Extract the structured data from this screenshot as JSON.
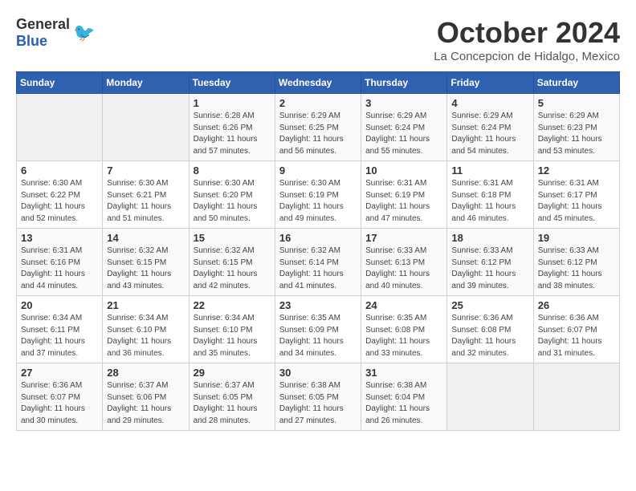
{
  "logo": {
    "general": "General",
    "blue": "Blue"
  },
  "title": "October 2024",
  "location": "La Concepcion de Hidalgo, Mexico",
  "headers": [
    "Sunday",
    "Monday",
    "Tuesday",
    "Wednesday",
    "Thursday",
    "Friday",
    "Saturday"
  ],
  "weeks": [
    [
      {
        "num": "",
        "sunrise": "",
        "sunset": "",
        "daylight": ""
      },
      {
        "num": "",
        "sunrise": "",
        "sunset": "",
        "daylight": ""
      },
      {
        "num": "1",
        "sunrise": "Sunrise: 6:28 AM",
        "sunset": "Sunset: 6:26 PM",
        "daylight": "Daylight: 11 hours and 57 minutes."
      },
      {
        "num": "2",
        "sunrise": "Sunrise: 6:29 AM",
        "sunset": "Sunset: 6:25 PM",
        "daylight": "Daylight: 11 hours and 56 minutes."
      },
      {
        "num": "3",
        "sunrise": "Sunrise: 6:29 AM",
        "sunset": "Sunset: 6:24 PM",
        "daylight": "Daylight: 11 hours and 55 minutes."
      },
      {
        "num": "4",
        "sunrise": "Sunrise: 6:29 AM",
        "sunset": "Sunset: 6:24 PM",
        "daylight": "Daylight: 11 hours and 54 minutes."
      },
      {
        "num": "5",
        "sunrise": "Sunrise: 6:29 AM",
        "sunset": "Sunset: 6:23 PM",
        "daylight": "Daylight: 11 hours and 53 minutes."
      }
    ],
    [
      {
        "num": "6",
        "sunrise": "Sunrise: 6:30 AM",
        "sunset": "Sunset: 6:22 PM",
        "daylight": "Daylight: 11 hours and 52 minutes."
      },
      {
        "num": "7",
        "sunrise": "Sunrise: 6:30 AM",
        "sunset": "Sunset: 6:21 PM",
        "daylight": "Daylight: 11 hours and 51 minutes."
      },
      {
        "num": "8",
        "sunrise": "Sunrise: 6:30 AM",
        "sunset": "Sunset: 6:20 PM",
        "daylight": "Daylight: 11 hours and 50 minutes."
      },
      {
        "num": "9",
        "sunrise": "Sunrise: 6:30 AM",
        "sunset": "Sunset: 6:19 PM",
        "daylight": "Daylight: 11 hours and 49 minutes."
      },
      {
        "num": "10",
        "sunrise": "Sunrise: 6:31 AM",
        "sunset": "Sunset: 6:19 PM",
        "daylight": "Daylight: 11 hours and 47 minutes."
      },
      {
        "num": "11",
        "sunrise": "Sunrise: 6:31 AM",
        "sunset": "Sunset: 6:18 PM",
        "daylight": "Daylight: 11 hours and 46 minutes."
      },
      {
        "num": "12",
        "sunrise": "Sunrise: 6:31 AM",
        "sunset": "Sunset: 6:17 PM",
        "daylight": "Daylight: 11 hours and 45 minutes."
      }
    ],
    [
      {
        "num": "13",
        "sunrise": "Sunrise: 6:31 AM",
        "sunset": "Sunset: 6:16 PM",
        "daylight": "Daylight: 11 hours and 44 minutes."
      },
      {
        "num": "14",
        "sunrise": "Sunrise: 6:32 AM",
        "sunset": "Sunset: 6:15 PM",
        "daylight": "Daylight: 11 hours and 43 minutes."
      },
      {
        "num": "15",
        "sunrise": "Sunrise: 6:32 AM",
        "sunset": "Sunset: 6:15 PM",
        "daylight": "Daylight: 11 hours and 42 minutes."
      },
      {
        "num": "16",
        "sunrise": "Sunrise: 6:32 AM",
        "sunset": "Sunset: 6:14 PM",
        "daylight": "Daylight: 11 hours and 41 minutes."
      },
      {
        "num": "17",
        "sunrise": "Sunrise: 6:33 AM",
        "sunset": "Sunset: 6:13 PM",
        "daylight": "Daylight: 11 hours and 40 minutes."
      },
      {
        "num": "18",
        "sunrise": "Sunrise: 6:33 AM",
        "sunset": "Sunset: 6:12 PM",
        "daylight": "Daylight: 11 hours and 39 minutes."
      },
      {
        "num": "19",
        "sunrise": "Sunrise: 6:33 AM",
        "sunset": "Sunset: 6:12 PM",
        "daylight": "Daylight: 11 hours and 38 minutes."
      }
    ],
    [
      {
        "num": "20",
        "sunrise": "Sunrise: 6:34 AM",
        "sunset": "Sunset: 6:11 PM",
        "daylight": "Daylight: 11 hours and 37 minutes."
      },
      {
        "num": "21",
        "sunrise": "Sunrise: 6:34 AM",
        "sunset": "Sunset: 6:10 PM",
        "daylight": "Daylight: 11 hours and 36 minutes."
      },
      {
        "num": "22",
        "sunrise": "Sunrise: 6:34 AM",
        "sunset": "Sunset: 6:10 PM",
        "daylight": "Daylight: 11 hours and 35 minutes."
      },
      {
        "num": "23",
        "sunrise": "Sunrise: 6:35 AM",
        "sunset": "Sunset: 6:09 PM",
        "daylight": "Daylight: 11 hours and 34 minutes."
      },
      {
        "num": "24",
        "sunrise": "Sunrise: 6:35 AM",
        "sunset": "Sunset: 6:08 PM",
        "daylight": "Daylight: 11 hours and 33 minutes."
      },
      {
        "num": "25",
        "sunrise": "Sunrise: 6:36 AM",
        "sunset": "Sunset: 6:08 PM",
        "daylight": "Daylight: 11 hours and 32 minutes."
      },
      {
        "num": "26",
        "sunrise": "Sunrise: 6:36 AM",
        "sunset": "Sunset: 6:07 PM",
        "daylight": "Daylight: 11 hours and 31 minutes."
      }
    ],
    [
      {
        "num": "27",
        "sunrise": "Sunrise: 6:36 AM",
        "sunset": "Sunset: 6:07 PM",
        "daylight": "Daylight: 11 hours and 30 minutes."
      },
      {
        "num": "28",
        "sunrise": "Sunrise: 6:37 AM",
        "sunset": "Sunset: 6:06 PM",
        "daylight": "Daylight: 11 hours and 29 minutes."
      },
      {
        "num": "29",
        "sunrise": "Sunrise: 6:37 AM",
        "sunset": "Sunset: 6:05 PM",
        "daylight": "Daylight: 11 hours and 28 minutes."
      },
      {
        "num": "30",
        "sunrise": "Sunrise: 6:38 AM",
        "sunset": "Sunset: 6:05 PM",
        "daylight": "Daylight: 11 hours and 27 minutes."
      },
      {
        "num": "31",
        "sunrise": "Sunrise: 6:38 AM",
        "sunset": "Sunset: 6:04 PM",
        "daylight": "Daylight: 11 hours and 26 minutes."
      },
      {
        "num": "",
        "sunrise": "",
        "sunset": "",
        "daylight": ""
      },
      {
        "num": "",
        "sunrise": "",
        "sunset": "",
        "daylight": ""
      }
    ]
  ]
}
